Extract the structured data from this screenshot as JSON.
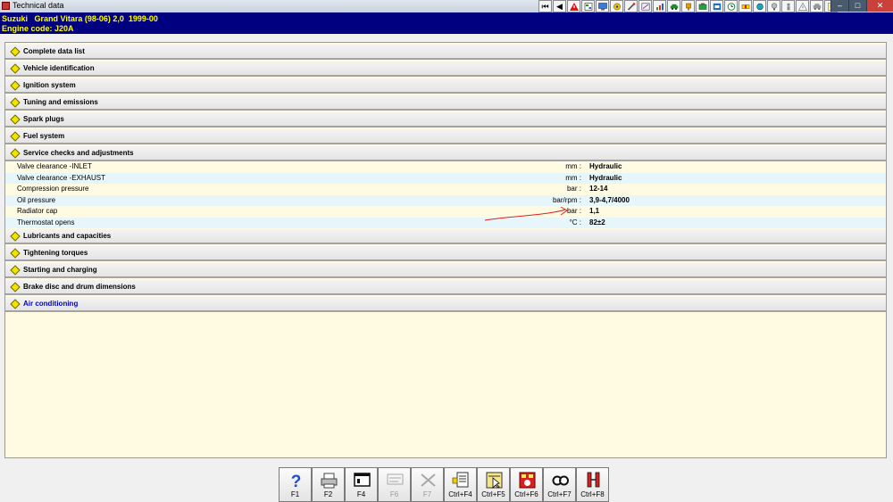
{
  "window": {
    "title": "Technical data",
    "controls": [
      "–",
      "□",
      "✕"
    ]
  },
  "toolbar": {
    "nav_first": "⏮",
    "nav_prev": "◀"
  },
  "vehicle": {
    "line1": "Suzuki   Grand Vitara (98-06) 2,0  1999-00",
    "line2": "Engine code: J20A"
  },
  "sections": [
    {
      "label": "Complete data list"
    },
    {
      "label": "Vehicle identification"
    },
    {
      "label": "Ignition system"
    },
    {
      "label": "Tuning and emissions"
    },
    {
      "label": "Spark plugs"
    },
    {
      "label": "Fuel system"
    },
    {
      "label": "Service checks and adjustments"
    },
    {
      "label": "Lubricants and capacities"
    },
    {
      "label": "Tightening torques"
    },
    {
      "label": "Starting and charging"
    },
    {
      "label": "Brake disc and drum dimensions"
    },
    {
      "label": "Air conditioning"
    }
  ],
  "service_rows": [
    {
      "param": "Valve clearance  -INLET",
      "unit": "mm :",
      "value": "Hydraulic"
    },
    {
      "param": "Valve clearance  -EXHAUST",
      "unit": "mm :",
      "value": "Hydraulic"
    },
    {
      "param": "Compression pressure",
      "unit": "bar :",
      "value": "12-14"
    },
    {
      "param": "Oil pressure",
      "unit": "bar/rpm :",
      "value": "3,9-4,7/4000"
    },
    {
      "param": "Radiator cap",
      "unit": "bar :",
      "value": "1,1"
    },
    {
      "param": "Thermostat opens",
      "unit": "°C :",
      "value": "82±2"
    }
  ],
  "function_keys": [
    {
      "label": "F1",
      "icon": "help-icon"
    },
    {
      "label": "F2",
      "icon": "print-icon"
    },
    {
      "label": "F4",
      "icon": "window-icon"
    },
    {
      "label": "F6",
      "icon": "adjustment-values-icon"
    },
    {
      "label": "F7",
      "icon": "tools-icon"
    },
    {
      "label": "Ctrl+F4",
      "icon": "document-tag-icon"
    },
    {
      "label": "Ctrl+F5",
      "icon": "pointer-page-icon"
    },
    {
      "label": "Ctrl+F6",
      "icon": "red-document-icon"
    },
    {
      "label": "Ctrl+F7",
      "icon": "search-glasses-icon"
    },
    {
      "label": "Ctrl+F8",
      "icon": "measurement-icon"
    }
  ],
  "colors": {
    "header_bg": "#000080",
    "header_text": "#ffff00",
    "content_bg": "#fffbe3",
    "row_alt_bg": "#e6f6fa",
    "link_text": "#0000cc",
    "annotation": "#e02020"
  }
}
